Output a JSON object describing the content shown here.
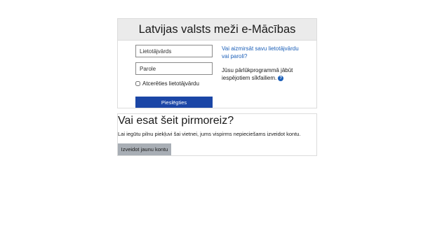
{
  "login": {
    "title": "Latvijas valsts meži e-Mācības",
    "username_placeholder": "Lietotājvārds",
    "password_placeholder": "Parole",
    "remember_label": "Atcerēties lietotājvārdu",
    "login_button": "Pieslēgties",
    "forgot_link": "Vai aizmirsāt savu lietotājvārdu vai paroli?",
    "cookie_note": "Jūsu pārlūkprogrammā jābūt iespējotiem sīkfailiem.",
    "help_icon": "?"
  },
  "signup": {
    "title": "Vai esat šeit pirmoreiz?",
    "text": "Lai iegūtu pilnu piekļuvi šai vietnei, jums vispirms nepieciešams izveidot kontu.",
    "button": "Izveidot jaunu kontu"
  }
}
